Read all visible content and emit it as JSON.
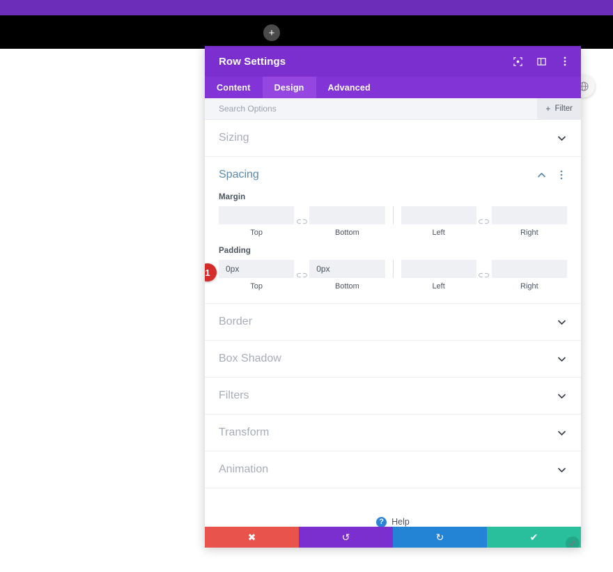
{
  "background": {
    "top_strip_color": "#6c2eb9",
    "band_color": "#000000",
    "add_button_glyph": "+"
  },
  "side_widget": {
    "icon": "globe-icon"
  },
  "modal": {
    "title": "Row Settings",
    "header_color": "#7b2fce",
    "header_icons": [
      {
        "name": "focus-icon"
      },
      {
        "name": "layout-panel-icon"
      },
      {
        "name": "more-vertical-icon"
      }
    ],
    "tabs": [
      {
        "label": "Content",
        "active": false
      },
      {
        "label": "Design",
        "active": true
      },
      {
        "label": "Advanced",
        "active": false
      }
    ],
    "search": {
      "placeholder": "Search Options",
      "value": "",
      "filter_label": "Filter",
      "filter_plus": "+"
    },
    "sections": [
      {
        "label": "Sizing",
        "state": "collapsed"
      },
      {
        "label": "Spacing",
        "state": "expanded"
      },
      {
        "label": "Border",
        "state": "collapsed"
      },
      {
        "label": "Box Shadow",
        "state": "collapsed"
      },
      {
        "label": "Filters",
        "state": "collapsed"
      },
      {
        "label": "Transform",
        "state": "collapsed"
      },
      {
        "label": "Animation",
        "state": "collapsed"
      }
    ],
    "spacing": {
      "title": "Spacing",
      "margin": {
        "label": "Margin",
        "top": {
          "label": "Top",
          "value": "",
          "placeholder": ""
        },
        "bottom": {
          "label": "Bottom",
          "value": "",
          "placeholder": ""
        },
        "left": {
          "label": "Left",
          "value": "",
          "placeholder": ""
        },
        "right": {
          "label": "Right",
          "value": "",
          "placeholder": ""
        }
      },
      "padding": {
        "label": "Padding",
        "marker": "1",
        "top": {
          "label": "Top",
          "value": "0px",
          "placeholder": ""
        },
        "bottom": {
          "label": "Bottom",
          "value": "0px",
          "placeholder": ""
        },
        "left": {
          "label": "Left",
          "value": "",
          "placeholder": ""
        },
        "right": {
          "label": "Right",
          "value": "",
          "placeholder": ""
        }
      }
    },
    "help": {
      "label": "Help",
      "icon_glyph": "?"
    },
    "footer": [
      {
        "name": "cancel-button",
        "glyph": "✖",
        "color": "#e8534c"
      },
      {
        "name": "undo-button",
        "glyph": "↺",
        "color": "#7b2fce"
      },
      {
        "name": "redo-button",
        "glyph": "↻",
        "color": "#2383d4"
      },
      {
        "name": "save-button",
        "glyph": "✔",
        "color": "#29bf9c"
      }
    ]
  }
}
